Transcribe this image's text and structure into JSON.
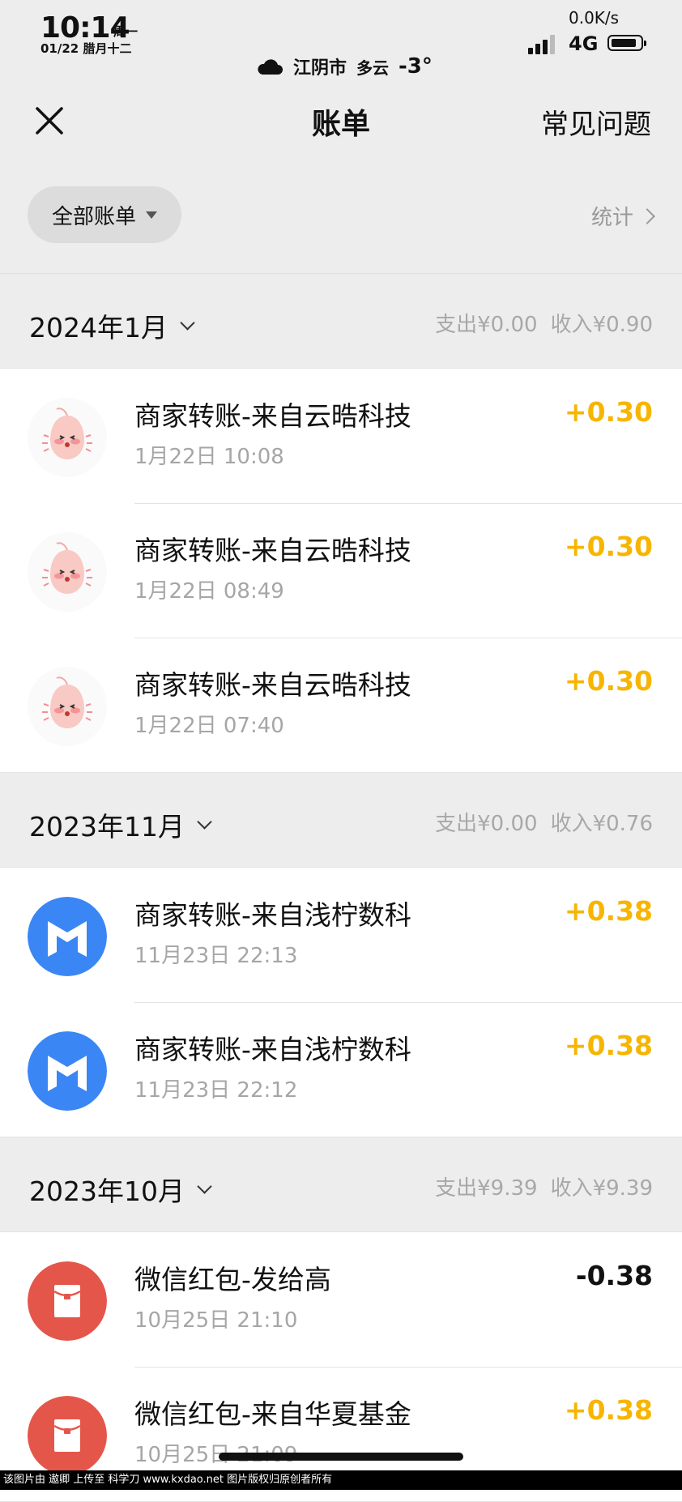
{
  "status_bar": {
    "time": "10:14",
    "weekday": "周一",
    "lunar_date": "01/22 腊月十二",
    "net_speed": "0.0K/s",
    "network": "4G",
    "weather_city": "江阴市",
    "weather_desc": "多云",
    "weather_temp": "-3°"
  },
  "nav": {
    "title": "账单",
    "faq": "常见问题"
  },
  "filter": {
    "label": "全部账单",
    "stats": "统计"
  },
  "months": [
    {
      "label": "2024年1月",
      "expense": "支出¥0.00",
      "income": "收入¥0.90",
      "items": [
        {
          "title": "商家转账-来自云晧科技",
          "time": "1月22日 10:08",
          "amount": "+0.30",
          "icon": "peach-avatar-icon"
        },
        {
          "title": "商家转账-来自云晧科技",
          "time": "1月22日 08:49",
          "amount": "+0.30",
          "icon": "peach-avatar-icon"
        },
        {
          "title": "商家转账-来自云晧科技",
          "time": "1月22日 07:40",
          "amount": "+0.30",
          "icon": "peach-avatar-icon"
        }
      ]
    },
    {
      "label": "2023年11月",
      "expense": "支出¥0.00",
      "income": "收入¥0.76",
      "items": [
        {
          "title": "商家转账-来自浅柠数科",
          "time": "11月23日 22:13",
          "amount": "+0.38",
          "icon": "m-logo-icon"
        },
        {
          "title": "商家转账-来自浅柠数科",
          "time": "11月23日 22:12",
          "amount": "+0.38",
          "icon": "m-logo-icon"
        }
      ]
    },
    {
      "label": "2023年10月",
      "expense": "支出¥9.39",
      "income": "收入¥9.39",
      "items": [
        {
          "title": "微信红包-发给高",
          "time": "10月25日 21:10",
          "amount": "-0.38",
          "icon": "red-packet-icon"
        },
        {
          "title": "微信红包-来自华夏基金",
          "time": "10月25日 21:09",
          "amount": "+0.38",
          "icon": "red-packet-icon"
        }
      ]
    }
  ],
  "footer_watermark": "该图片由 遨卿 上传至 科学刀 www.kxdao.net 图片版权归原创者所有",
  "colors": {
    "income": "#f7b500",
    "expense": "#111111",
    "background": "#ededed",
    "m_logo_blue": "#3a86f5",
    "red_packet": "#e5564a"
  }
}
